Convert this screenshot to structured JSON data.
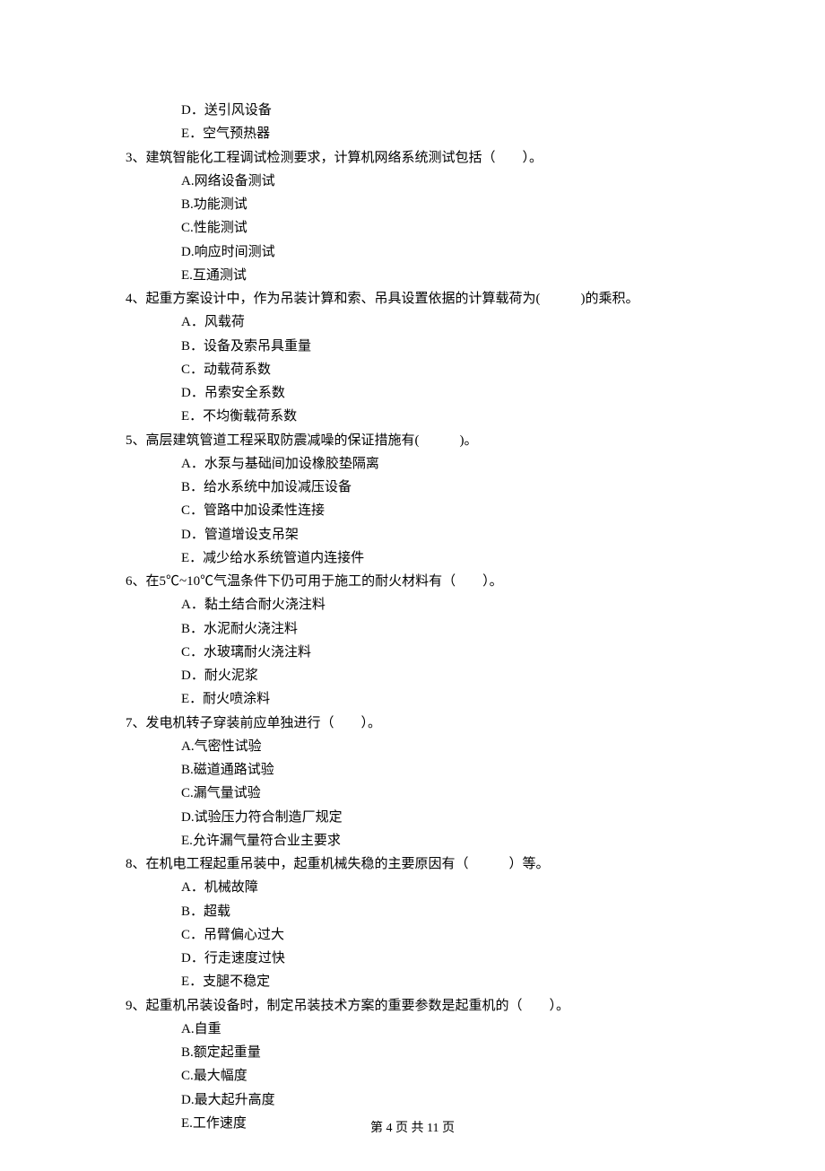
{
  "orphan_options": [
    "D．送引风设备",
    "E．空气预热器"
  ],
  "questions": [
    {
      "num": "3、",
      "text": "建筑智能化工程调试检测要求，计算机网络系统测试包括（　　）。",
      "options": [
        "A.网络设备测试",
        "B.功能测试",
        "C.性能测试",
        "D.响应时间测试",
        "E.互通测试"
      ]
    },
    {
      "num": "4、",
      "text": "起重方案设计中，作为吊装计算和索、吊具设置依据的计算载荷为(　　　)的乘积。",
      "options": [
        "A．风载荷",
        "B．设备及索吊具重量",
        "C．动载荷系数",
        "D．吊索安全系数",
        "E．不均衡载荷系数"
      ]
    },
    {
      "num": "5、",
      "text": "高层建筑管道工程采取防震减噪的保证措施有(　　　)。",
      "options": [
        "A．水泵与基础间加设橡胶垫隔离",
        "B．给水系统中加设减压设备",
        "C．管路中加设柔性连接",
        "D．管道增设支吊架",
        "E．减少给水系统管道内连接件"
      ]
    },
    {
      "num": "6、",
      "text": "在5℃~10℃气温条件下仍可用于施工的耐火材料有（　　）。",
      "options": [
        "A．黏土结合耐火浇注料",
        "B．水泥耐火浇注料",
        "C．水玻璃耐火浇注料",
        "D．耐火泥浆",
        "E．耐火喷涂料"
      ]
    },
    {
      "num": "7、",
      "text": "发电机转子穿装前应单独进行（　　）。",
      "options": [
        "A.气密性试验",
        "B.磁道通路试验",
        "C.漏气量试验",
        "D.试验压力符合制造厂规定",
        "E.允许漏气量符合业主要求"
      ]
    },
    {
      "num": "8、",
      "text": "在机电工程起重吊装中，起重机械失稳的主要原因有（　　　）等。",
      "options": [
        "A．机械故障",
        "B．超载",
        "C．吊臂偏心过大",
        "D．行走速度过快",
        "E．支腿不稳定"
      ]
    },
    {
      "num": "9、",
      "text": "起重机吊装设备时，制定吊装技术方案的重要参数是起重机的（　　）。",
      "options": [
        "A.自重",
        "B.额定起重量",
        "C.最大幅度",
        "D.最大起升高度",
        "E.工作速度"
      ]
    }
  ],
  "footer": "第 4 页 共 11 页"
}
